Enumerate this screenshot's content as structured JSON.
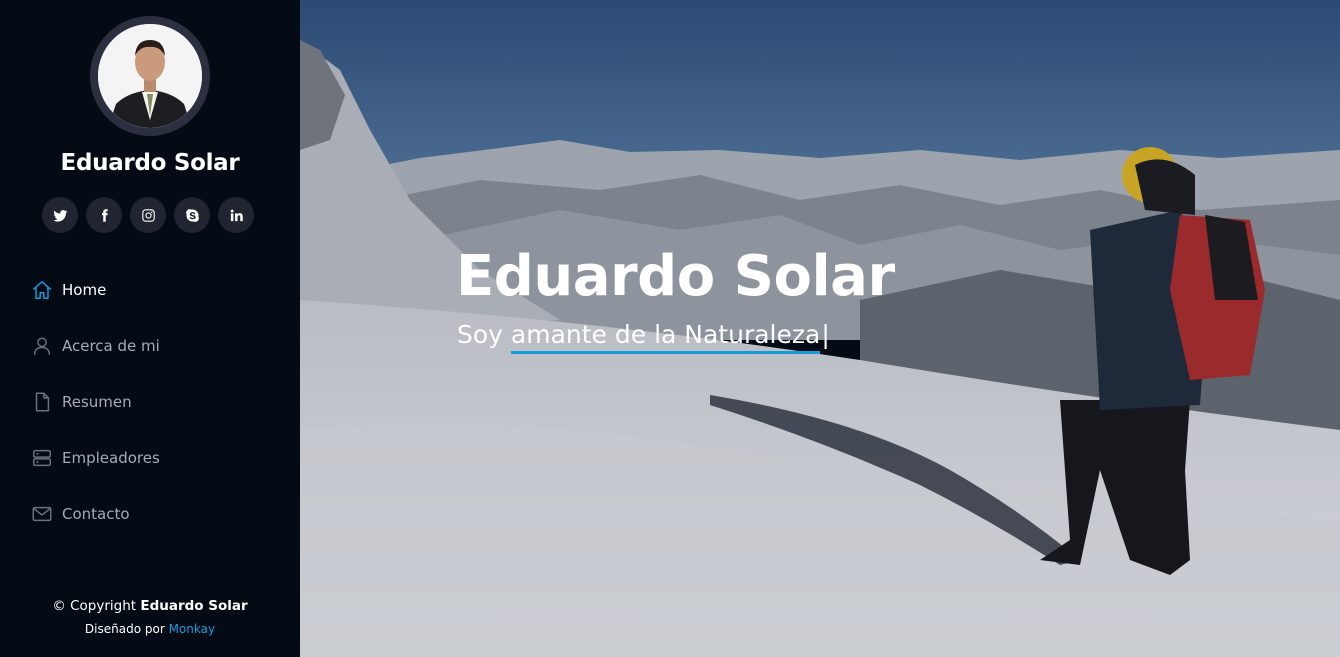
{
  "profile": {
    "name": "Eduardo Solar"
  },
  "social": [
    "twitter-icon",
    "facebook-icon",
    "instagram-icon",
    "skype-icon",
    "linkedin-icon"
  ],
  "nav": {
    "items": [
      {
        "label": "Home",
        "icon": "home-icon",
        "active": true
      },
      {
        "label": "Acerca de mi",
        "icon": "user-icon",
        "active": false
      },
      {
        "label": "Resumen",
        "icon": "file-icon",
        "active": false
      },
      {
        "label": "Empleadores",
        "icon": "server-icon",
        "active": false
      },
      {
        "label": "Contacto",
        "icon": "envelope-icon",
        "active": false
      }
    ]
  },
  "footer": {
    "copyright_prefix": "© Copyright ",
    "copyright_name": "Eduardo Solar",
    "designed_by": "Diseñado por ",
    "designer": "Monkay"
  },
  "hero": {
    "title": "Eduardo Solar",
    "subtitle_prefix": "Soy ",
    "subtitle_typed": "amante de la Naturaleza",
    "cursor": "|"
  },
  "colors": {
    "accent": "#149ddd",
    "sidebar_bg": "#040b14",
    "social_bg": "#212431"
  }
}
